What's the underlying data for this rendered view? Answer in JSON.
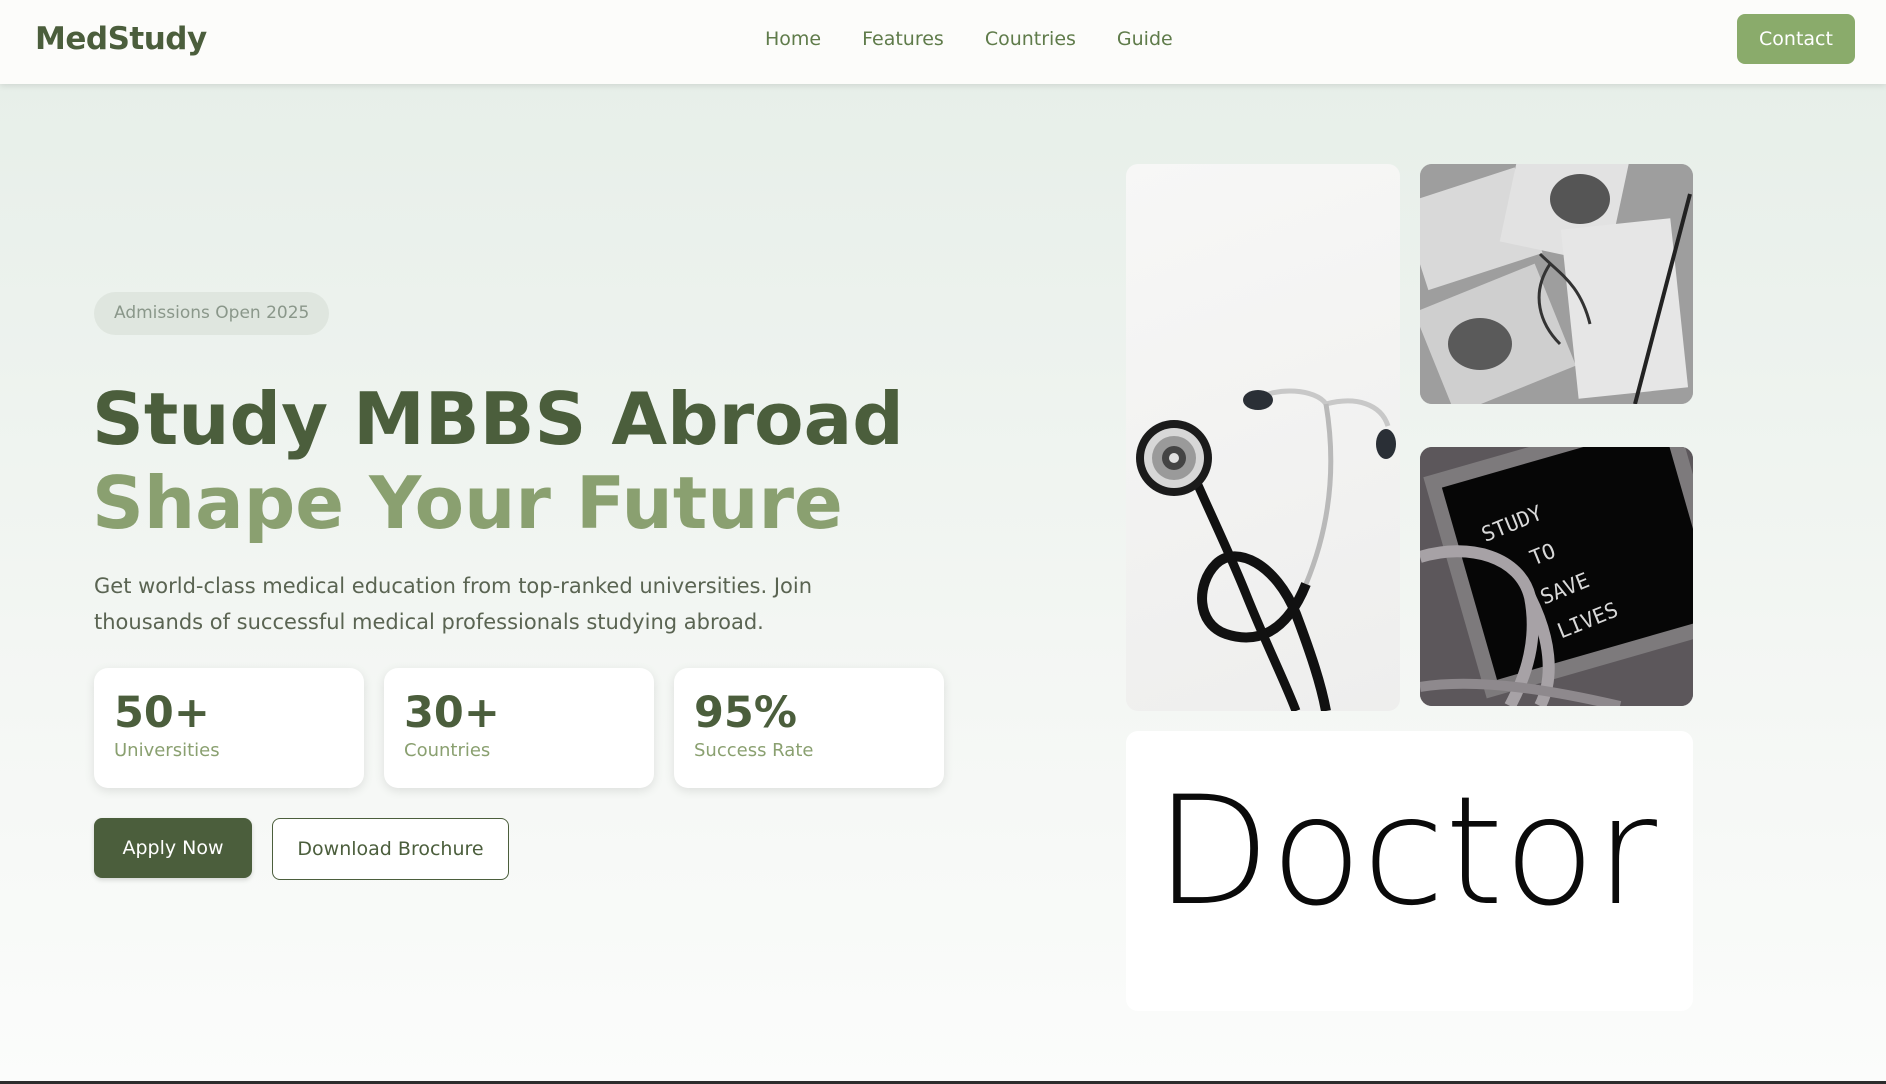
{
  "nav": {
    "brand": "MedStudy",
    "links": [
      "Home",
      "Features",
      "Countries",
      "Guide"
    ],
    "contact_label": "Contact"
  },
  "hero": {
    "badge": "Admissions Open 2025",
    "headline_line1": "Study MBBS Abroad",
    "headline_line2": "Shape Your Future",
    "subtitle": "Get world-class medical education from top-ranked universities. Join thousands of successful medical professionals studying abroad.",
    "stats": [
      {
        "value": "50+",
        "label": "Universities"
      },
      {
        "value": "30+",
        "label": "Countries"
      },
      {
        "value": "95%",
        "label": "Success Rate"
      }
    ],
    "apply_label": "Apply Now",
    "brochure_label": "Download Brochure"
  },
  "gallery": {
    "board_lines": [
      "STUDY",
      "TO",
      "SAVE",
      "LIVES"
    ],
    "doctor_logo_text": "Doctor"
  },
  "colors": {
    "primary": "#4b5e3c",
    "accent": "#8aab6b",
    "secondary": "#8aa070"
  }
}
